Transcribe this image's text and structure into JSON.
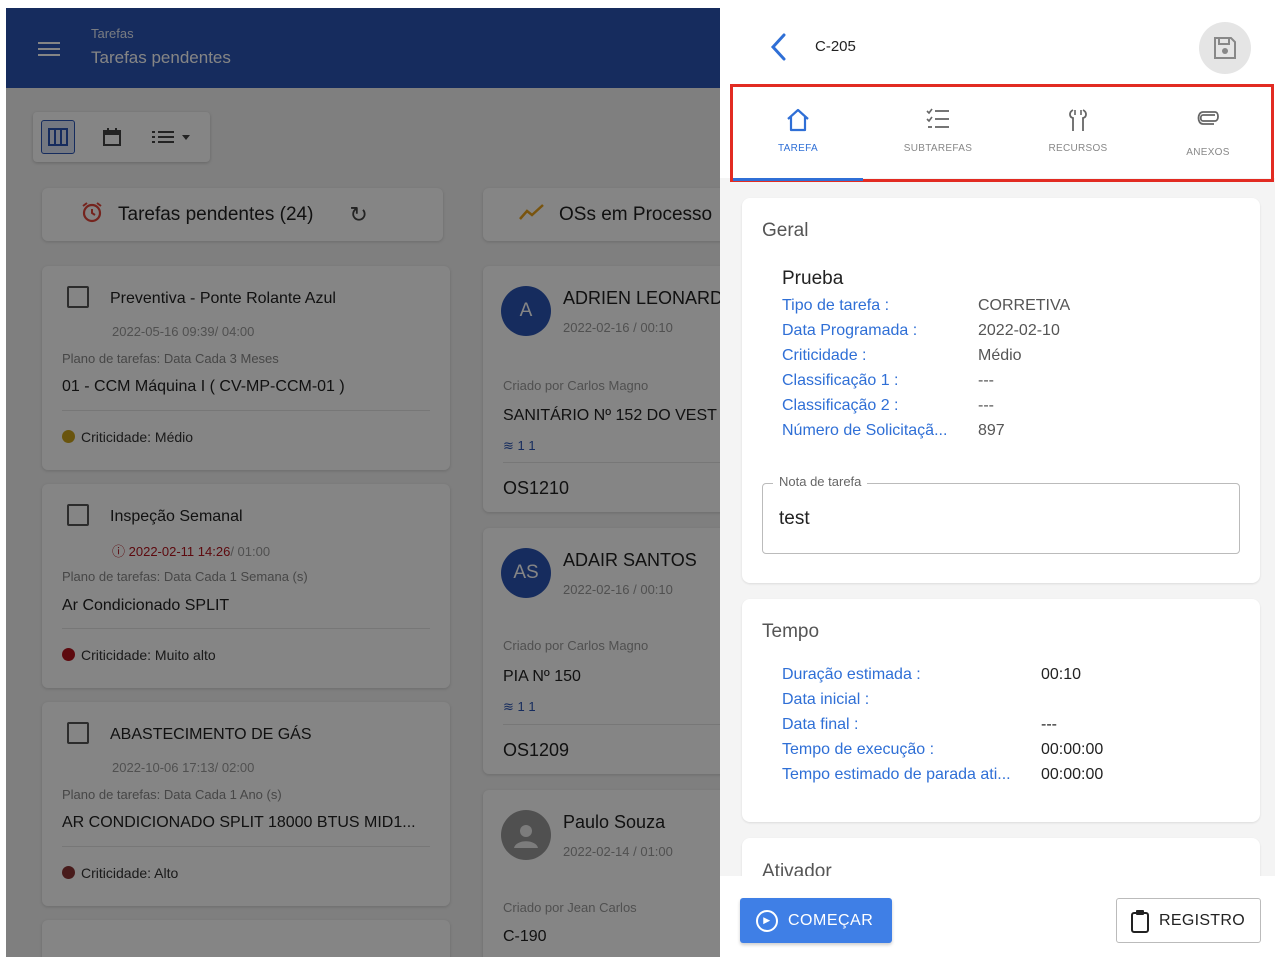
{
  "app_bar": {
    "section": "Tarefas",
    "title": "Tarefas pendentes"
  },
  "columns": [
    {
      "title": "Tarefas pendentes (24)"
    },
    {
      "title": "OSs em Processo"
    }
  ],
  "pending_tasks": [
    {
      "title": "Preventiva - Ponte Rolante Azul",
      "datetime": "2022-05-16 09:39/ 04:00",
      "overdue": "",
      "plan": "Plano de tarefas: Data Cada 3 Meses",
      "asset": "01 - CCM Máquina I ( CV-MP-CCM-01 )",
      "criticality": "Criticidade: Médio",
      "dot_color": "#c9a21a"
    },
    {
      "title": "Inspeção Semanal",
      "datetime": "/ 01:00",
      "overdue": "2022-02-11 14:26",
      "plan": "Plano de tarefas: Data Cada 1 Semana (s)",
      "asset": "Ar Condicionado SPLIT",
      "criticality": "Criticidade: Muito alto",
      "dot_color": "#b3151e"
    },
    {
      "title": "ABASTECIMENTO DE GÁS",
      "datetime": "2022-10-06 17:13/ 02:00",
      "overdue": "",
      "plan": "Plano de tarefas: Data Cada 1 Ano (s)",
      "asset": "AR CONDICIONADO SPLIT 18000 BTUS MID1...",
      "criticality": "Criticidade: Alto",
      "dot_color": "#8a3535"
    }
  ],
  "work_orders": [
    {
      "initials": "A",
      "name": "ADRIEN LEONARD",
      "date": "2022-02-16 / 00:10",
      "created_by": "Criado por Carlos Magno",
      "desc": "SANITÁRIO Nº 152 DO VEST",
      "counts": "1   1",
      "os": "OS1210"
    },
    {
      "initials": "AS",
      "name": "ADAIR SANTOS",
      "date": "2022-02-16 / 00:10",
      "created_by": "Criado por Carlos Magno",
      "desc": "PIA Nº 150",
      "counts": "1   1",
      "os": "OS1209"
    },
    {
      "initials": "",
      "name": "Paulo Souza",
      "date": "2022-02-14 / 01:00",
      "created_by": "Criado por Jean Carlos",
      "desc": "C-190",
      "counts": "",
      "os": ""
    }
  ],
  "panel": {
    "title": "C-205",
    "tabs": [
      {
        "label": "TAREFA",
        "icon": "home-icon"
      },
      {
        "label": "SUBTAREFAS",
        "icon": "checklist-icon"
      },
      {
        "label": "RECURSOS",
        "icon": "tools-icon"
      },
      {
        "label": "ANEXOS",
        "icon": "paperclip-icon"
      }
    ],
    "general": {
      "heading": "Geral",
      "name": "Prueba",
      "fields": [
        {
          "label": "Tipo de tarefa :",
          "value": "CORRETIVA"
        },
        {
          "label": "Data Programada :",
          "value": "2022-02-10"
        },
        {
          "label": "Criticidade :",
          "value": "Médio"
        },
        {
          "label": "Classificação 1 :",
          "value": "---"
        },
        {
          "label": "Classificação 2 :",
          "value": "---"
        },
        {
          "label": "Número de Solicitaçã...",
          "value": "897"
        }
      ],
      "note_label": "Nota de tarefa",
      "note_value": "test"
    },
    "time": {
      "heading": "Tempo",
      "fields": [
        {
          "label": "Duração estimada :",
          "value": "00:10"
        },
        {
          "label": "Data inicial :",
          "value": ""
        },
        {
          "label": "Data final :",
          "value": "---"
        },
        {
          "label": "Tempo de execução :",
          "value": "00:00:00"
        },
        {
          "label": "Tempo estimado de parada ati...",
          "value": "00:00:00"
        }
      ]
    },
    "trigger": {
      "heading": "Ativador"
    },
    "buttons": {
      "start": "COMEÇAR",
      "log": "REGISTRO"
    }
  },
  "colors": {
    "primary": "#2b55b4",
    "accent": "#2f6fd6",
    "highlight_box": "#e22b22"
  }
}
